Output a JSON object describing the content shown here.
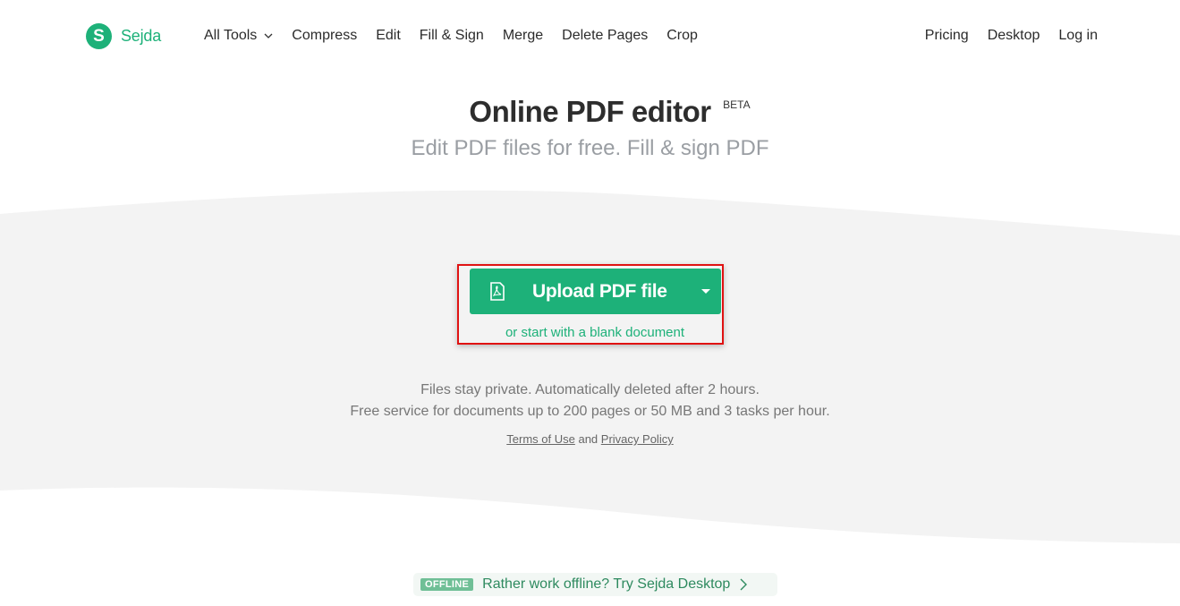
{
  "brand": {
    "logo_letter": "S",
    "name": "Sejda",
    "color": "#1db179"
  },
  "nav": {
    "left": [
      "All Tools",
      "Compress",
      "Edit",
      "Fill & Sign",
      "Merge",
      "Delete Pages",
      "Crop"
    ],
    "right": [
      "Pricing",
      "Desktop",
      "Log in"
    ]
  },
  "hero": {
    "title": "Online PDF editor",
    "badge": "BETA",
    "subtitle": "Edit PDF files for free. Fill & sign PDF"
  },
  "upload": {
    "button_label": "Upload PDF file",
    "blank_link": "or start with a blank document",
    "icon": "pdf-file-icon"
  },
  "info": {
    "line1": "Files stay private. Automatically deleted after 2 hours.",
    "line2": "Free service for documents up to 200 pages or 50 MB and 3 tasks per hour."
  },
  "legal": {
    "terms": "Terms of Use",
    "and": "and",
    "privacy": "Privacy Policy"
  },
  "promo": {
    "badge": "OFFLINE",
    "text": "Rather work offline? Try Sejda Desktop"
  },
  "colors": {
    "accent": "#1db179",
    "highlight_border": "#e01212",
    "band": "#f3f3f3"
  }
}
